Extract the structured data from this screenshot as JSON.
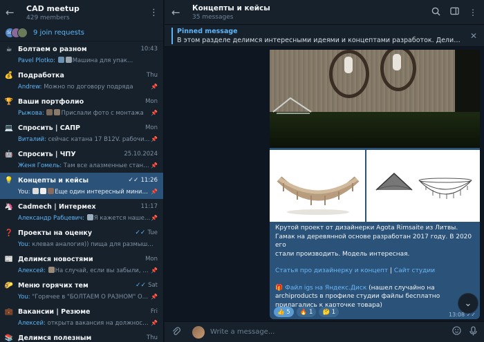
{
  "sidebar": {
    "title": "CAD meetup",
    "subtitle": "429 members",
    "join_requests": "9 join requests",
    "join_avatars": [
      {
        "initials": "SG",
        "color": "#4f86c6"
      },
      {
        "initials": "",
        "color": "#8a6a9a"
      },
      {
        "initials": "",
        "color": "#6a7a5a"
      }
    ],
    "chats": [
      {
        "icon": "☕",
        "name": "Болтаем о разном",
        "time": "10:43",
        "sender": "Pavel Plotko:",
        "preview": "Машина для упак...",
        "thumbs": [
          "#6d8fb0",
          "#9aa4ae"
        ],
        "pinned": false,
        "read": false,
        "active": false
      },
      {
        "icon": "💰",
        "name": "Подработка",
        "time": "Thu",
        "sender": "Andrew:",
        "preview": "Можно по договору подряда",
        "thumbs": [],
        "pinned": true,
        "read": false,
        "active": false
      },
      {
        "icon": "🏆",
        "name": "Ваши портфолио",
        "time": "Mon",
        "sender": "Рыжова:",
        "preview": "Прислали фото с монтажа",
        "thumbs": [
          "#7a6a5a",
          "#8a7a6a"
        ],
        "pinned": true,
        "read": false,
        "active": false
      },
      {
        "icon": "💻",
        "name": "Спросить | САПР",
        "time": "Mon",
        "sender": "Виталий:",
        "preview": "сейчас катана 17 B12V. рабочи...",
        "thumbs": [],
        "pinned": true,
        "read": false,
        "active": false
      },
      {
        "icon": "🤖",
        "name": "Спросить | ЧПУ",
        "time": "25.10.2024",
        "sender": "Женя Гомель:",
        "preview": "Там все алазменные станк...",
        "thumbs": [],
        "pinned": true,
        "read": false,
        "active": false
      },
      {
        "icon": "💡",
        "name": "Концепты и кейсы",
        "time": "11:26",
        "sender": "You:",
        "preview": "Еще один интересный миним...",
        "thumbs": [
          "#ddd",
          "#eee",
          "#8a6a5a"
        ],
        "pinned": true,
        "read": true,
        "active": true
      },
      {
        "icon": "🦄",
        "name": "Cadmech | Интермех",
        "time": "11:17",
        "sender": "Александр Рабцевич:",
        "preview": "Я кажется нашел ка...",
        "thumbs": [
          "#9ab0c0"
        ],
        "pinned": true,
        "read": false,
        "active": false
      },
      {
        "icon": "❓",
        "name": "Проекты на оценку",
        "time": "Tue",
        "sender": "You:",
        "preview": "клевая аналогия)) пища для размышлен...",
        "thumbs": [],
        "pinned": false,
        "read": true,
        "active": false
      },
      {
        "icon": "📰",
        "name": "Делимся новостями",
        "time": "Mon",
        "sender": "Алексей:",
        "preview": "На случай, если вы забыли, что ...",
        "thumbs": [
          "#9a8a7a"
        ],
        "pinned": true,
        "read": false,
        "active": false
      },
      {
        "icon": "🌮",
        "name": "Меню горячих тем",
        "time": "Sat",
        "sender": "You:",
        "preview": "\"Горячее в \"БОЛТАЕМ О РАЗНОМ\" Опрос...",
        "thumbs": [],
        "pinned": true,
        "read": true,
        "active": false
      },
      {
        "icon": "💼",
        "name": "Вакансии | Резюме",
        "time": "Fri",
        "sender": "Алексей:",
        "preview": "открыта вакансия на должность гла...",
        "thumbs": [],
        "pinned": true,
        "read": false,
        "active": false
      },
      {
        "icon": "📚",
        "name": "Делимся полезным",
        "time": "Thu",
        "sender": "",
        "preview": "",
        "thumbs": [],
        "pinned": false,
        "read": false,
        "active": false
      }
    ]
  },
  "header": {
    "title": "Концепты и кейсы",
    "subtitle": "35 messages"
  },
  "pinned": {
    "title": "Pinned message",
    "text": "В этом разделе делимся интересными идеями и концептами разработок. Делимся успешны..."
  },
  "message": {
    "lines": [
      "Крутой проект от дизайнерки Agota Rimsaite из Литвы.",
      "Гамак на деревянной основе разработан 2017 году. В 2020 его",
      "стали производить. Модель интересная."
    ],
    "link1": "Статья про дизайнерку и концепт",
    "separator": " | ",
    "link2": "Сайт студии",
    "gift_icon": "🎁",
    "link3": "Файл igs на Яндекс.Диск",
    "after_link3": " (нашел случайно на archiproducts в профиле студии файлы бесплатно прилагались к карточке товара)",
    "reactions": [
      {
        "emoji": "👍",
        "count": "5",
        "mine": true
      },
      {
        "emoji": "🔥",
        "count": "1",
        "mine": false
      },
      {
        "emoji": "🤔",
        "count": "1",
        "mine": false
      }
    ],
    "time": "13:08"
  },
  "composer": {
    "placeholder": "Write a message..."
  }
}
